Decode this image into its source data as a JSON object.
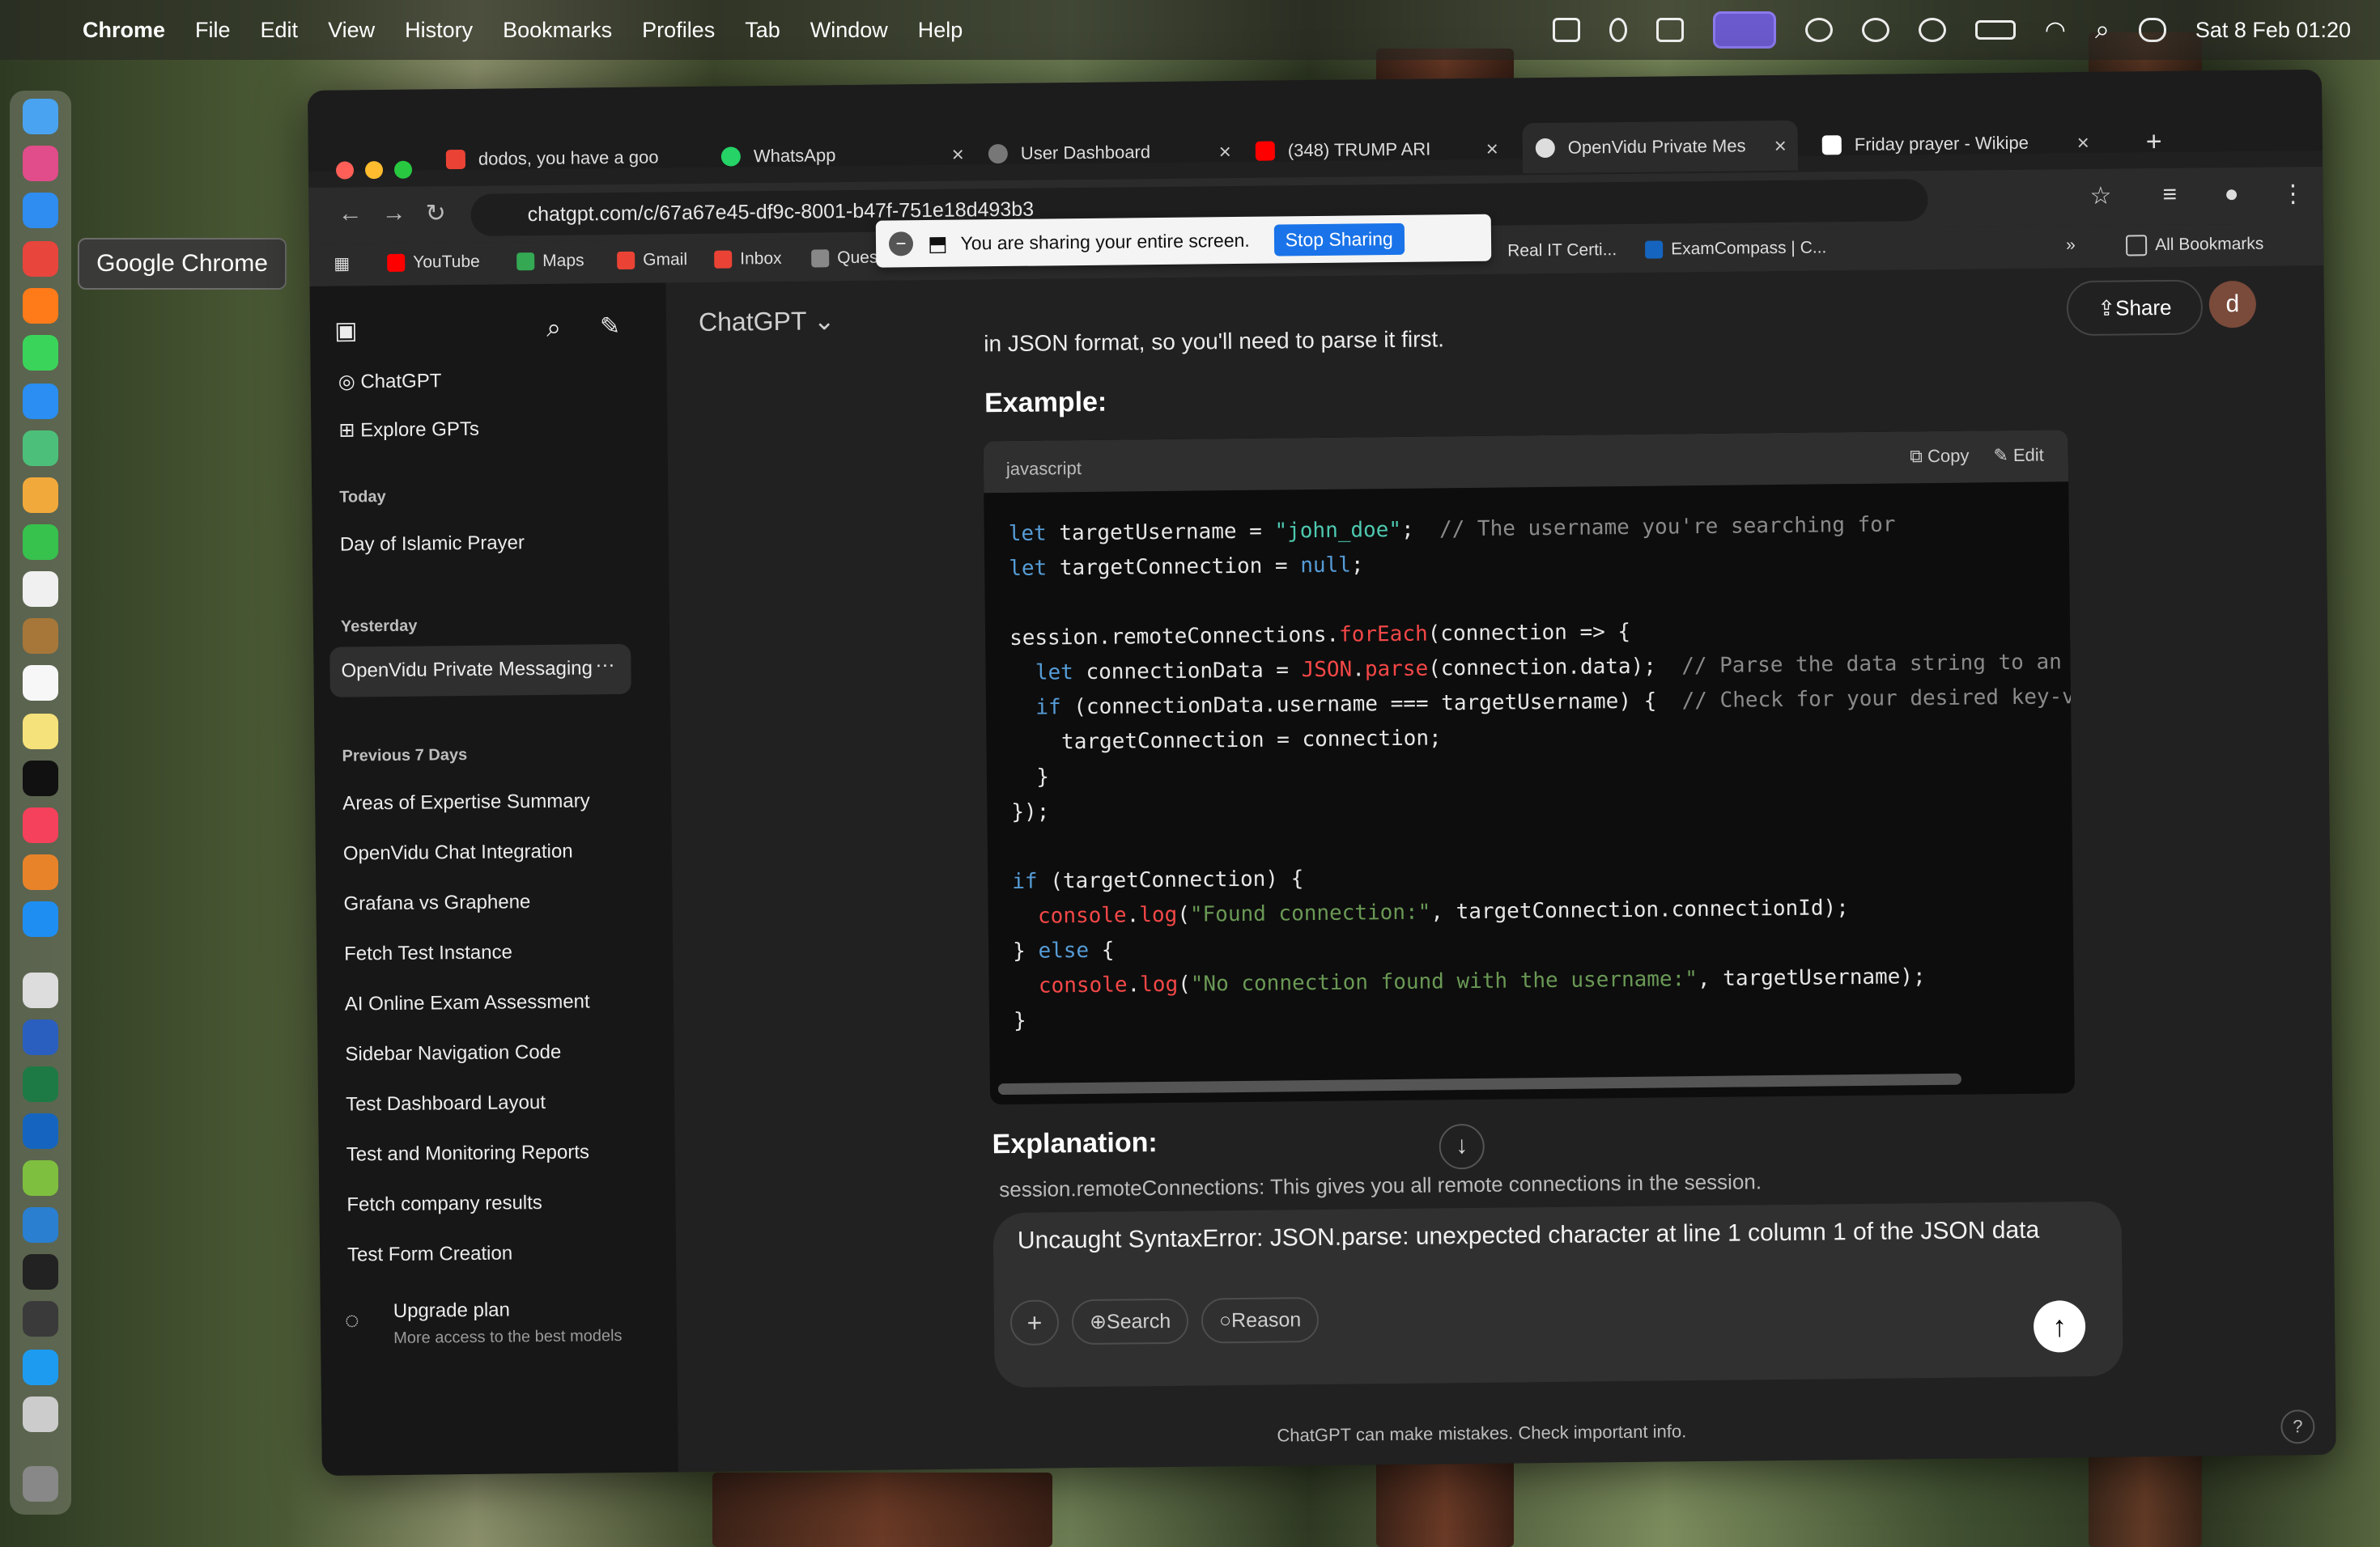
{
  "menubar": {
    "app": "Chrome",
    "items": [
      "File",
      "Edit",
      "View",
      "History",
      "Bookmarks",
      "Profiles",
      "Tab",
      "Window",
      "Help"
    ],
    "clock": "Sat 8 Feb  01:20"
  },
  "dock": {
    "tooltip": "Google Chrome"
  },
  "tabs": [
    {
      "label": "dodos, you have a goo",
      "icon": "gmail-icon"
    },
    {
      "label": "WhatsApp",
      "icon": "whatsapp-icon"
    },
    {
      "label": "User Dashboard",
      "icon": "globe-icon"
    },
    {
      "label": "(348) TRUMP ARI",
      "icon": "youtube-icon"
    },
    {
      "label": "OpenVidu Private Mes",
      "icon": "chatgpt-icon"
    },
    {
      "label": "Friday prayer - Wikipe",
      "icon": "wikipedia-icon"
    }
  ],
  "address": {
    "url": "chatgpt.com/c/67a67e45-df9c-8001-b47f-751e18d493b3"
  },
  "share_notice": {
    "text": "You are sharing your entire screen.",
    "stop": "Stop Sharing"
  },
  "bookmarks": {
    "items": [
      "YouTube",
      "Maps",
      "Gmail",
      "Inbox",
      "Questi",
      "Real IT Certi...",
      "ExamCompass | C..."
    ],
    "all": "All Bookmarks"
  },
  "sidebar": {
    "top": [
      "ChatGPT",
      "Explore GPTs"
    ],
    "today_head": "Today",
    "today": [
      "Day of Islamic Prayer"
    ],
    "yesterday_head": "Yesterday",
    "yesterday": [
      "OpenVidu Private Messaging"
    ],
    "prev_head": "Previous 7 Days",
    "prev": [
      "Areas of Expertise Summary",
      "OpenVidu Chat Integration",
      "Grafana vs Graphene",
      "Fetch Test Instance",
      "AI Online Exam Assessment",
      "Sidebar Navigation Code",
      "Test Dashboard Layout",
      "Test and Monitoring Reports",
      "Fetch company results",
      "Test Form Creation"
    ],
    "upgrade": "Upgrade plan",
    "upgrade_sub": "More access to the best models"
  },
  "main": {
    "model": "ChatGPT",
    "share": "Share",
    "avatar": "d",
    "intro": "in JSON format, so you'll need to parse it first.",
    "example": "Example:",
    "code_lang": "javascript",
    "copy": "Copy",
    "edit": "Edit",
    "explanation": "Explanation:",
    "bullet": "session.remoteConnections: This gives you all remote connections in the session."
  },
  "composer": {
    "text": "Uncaught SyntaxError: JSON.parse: unexpected character at line 1 column 1 of the JSON data",
    "search": "Search",
    "reason": "Reason"
  },
  "disclaimer": "ChatGPT can make mistakes. Check important info."
}
